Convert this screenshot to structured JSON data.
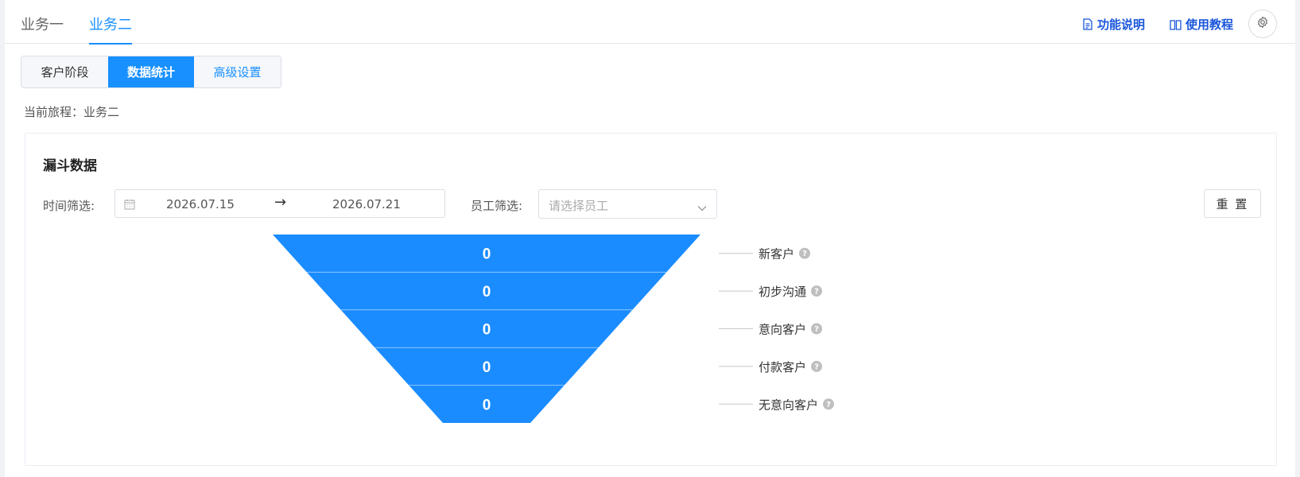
{
  "top_tabs": [
    {
      "label": "业务一",
      "active": false
    },
    {
      "label": "业务二",
      "active": true
    }
  ],
  "top_links": {
    "doc": {
      "label": "功能说明",
      "icon": "document-icon"
    },
    "tutorial": {
      "label": "使用教程",
      "icon": "book-icon"
    },
    "settings_icon": "gear-icon"
  },
  "sub_tabs": [
    {
      "label": "客户阶段",
      "active": false
    },
    {
      "label": "数据统计",
      "active": true
    },
    {
      "label": "高级设置",
      "active": false
    }
  ],
  "journey": {
    "text": "当前旅程：业务二"
  },
  "card": {
    "title": "漏斗数据",
    "filters": {
      "time_label": "时间筛选:",
      "start_date": "2026.07.15",
      "arrow": "→",
      "end_date": "2026.07.21",
      "employee_label": "员工筛选:",
      "employee_placeholder": "请选择员工",
      "reset_label": "重 置"
    }
  },
  "funnel": {
    "color": "#1a8cff",
    "stages": [
      {
        "name": "新客户",
        "value": 0
      },
      {
        "name": "初步沟通",
        "value": 0
      },
      {
        "name": "意向客户",
        "value": 0
      },
      {
        "name": "付款客户",
        "value": 0
      },
      {
        "name": "无意向客户",
        "value": 0
      }
    ],
    "help_icon": "question-circle-icon"
  }
}
